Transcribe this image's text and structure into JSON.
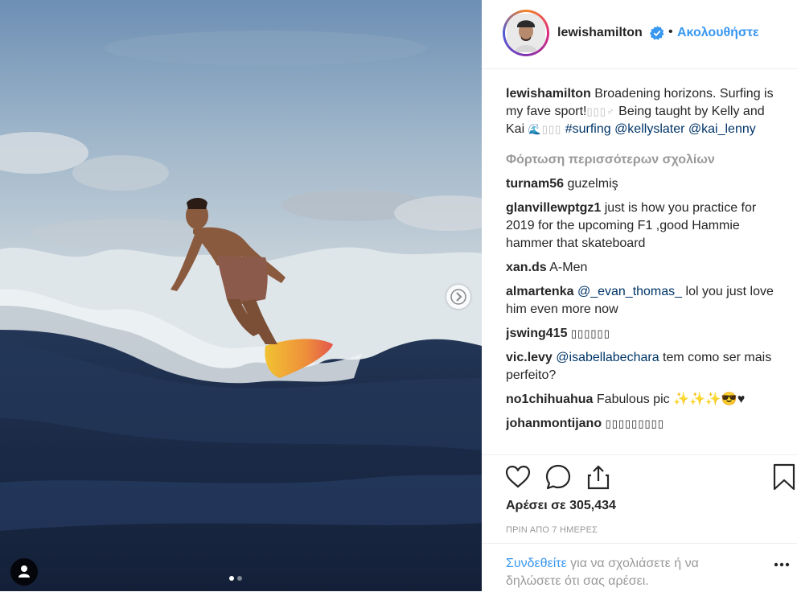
{
  "post": {
    "username": "lewishamilton",
    "follow_label": "Ακολουθήστε",
    "separator": "•",
    "caption": {
      "username": "lewishamilton",
      "text_1": " Broadening horizons. Surfing is my fave sport!",
      "glyphs_1": "▯▯▯♂",
      "text_2": " Being taught by Kelly and Kai ",
      "glyphs_2": "🌊▯▯▯",
      "hashtag": "#surfing",
      "mention_1": "@kellyslater",
      "mention_2": "@kai_lenny"
    },
    "load_more": "Φόρτωση περισσότερων σχολίων",
    "comments": [
      {
        "user": "turnam56",
        "text": "guzelmiş"
      },
      {
        "user": "glanvillewptgz1",
        "text": "just is how you practice for 2019 for the upcoming F1 ,good Hammie hammer that skateboard"
      },
      {
        "user": "xan.ds",
        "text": "A-Men"
      },
      {
        "user": "almartenka",
        "mention": "@_evan_thomas_",
        "text": " lol you just love him even more now"
      },
      {
        "user": "jswing415",
        "text": "▯▯▯▯▯▯"
      },
      {
        "user": "vic.levy",
        "mention": "@isabellabechara",
        "text": " tem como ser mais perfeito?"
      },
      {
        "user": "no1chihuahua",
        "text": "Fabulous pic ✨✨✨😎♥"
      },
      {
        "user": "johanmontijano",
        "text": "▯▯▯▯▯▯▯▯▯"
      }
    ],
    "likes": "Αρέσει σε 305,434",
    "time": "ΠΡΙΝ ΑΠΟ 7 ΗΜΕΡΕΣ",
    "login": {
      "link": "Συνδεθείτε",
      "text": " για να σχολιάσετε ή να δηλώσετε ότι σας αρέσει."
    },
    "carousel": {
      "count": 2,
      "active_index": 0
    }
  },
  "icons": [
    "heart-icon",
    "comment-icon",
    "share-icon",
    "bookmark-icon",
    "more-icon",
    "user-tag-icon",
    "chevron-right-icon",
    "verified-badge-icon"
  ],
  "colors": {
    "link_blue": "#3897f0",
    "mention_dark": "#003569",
    "muted": "#999999",
    "text": "#262626"
  }
}
